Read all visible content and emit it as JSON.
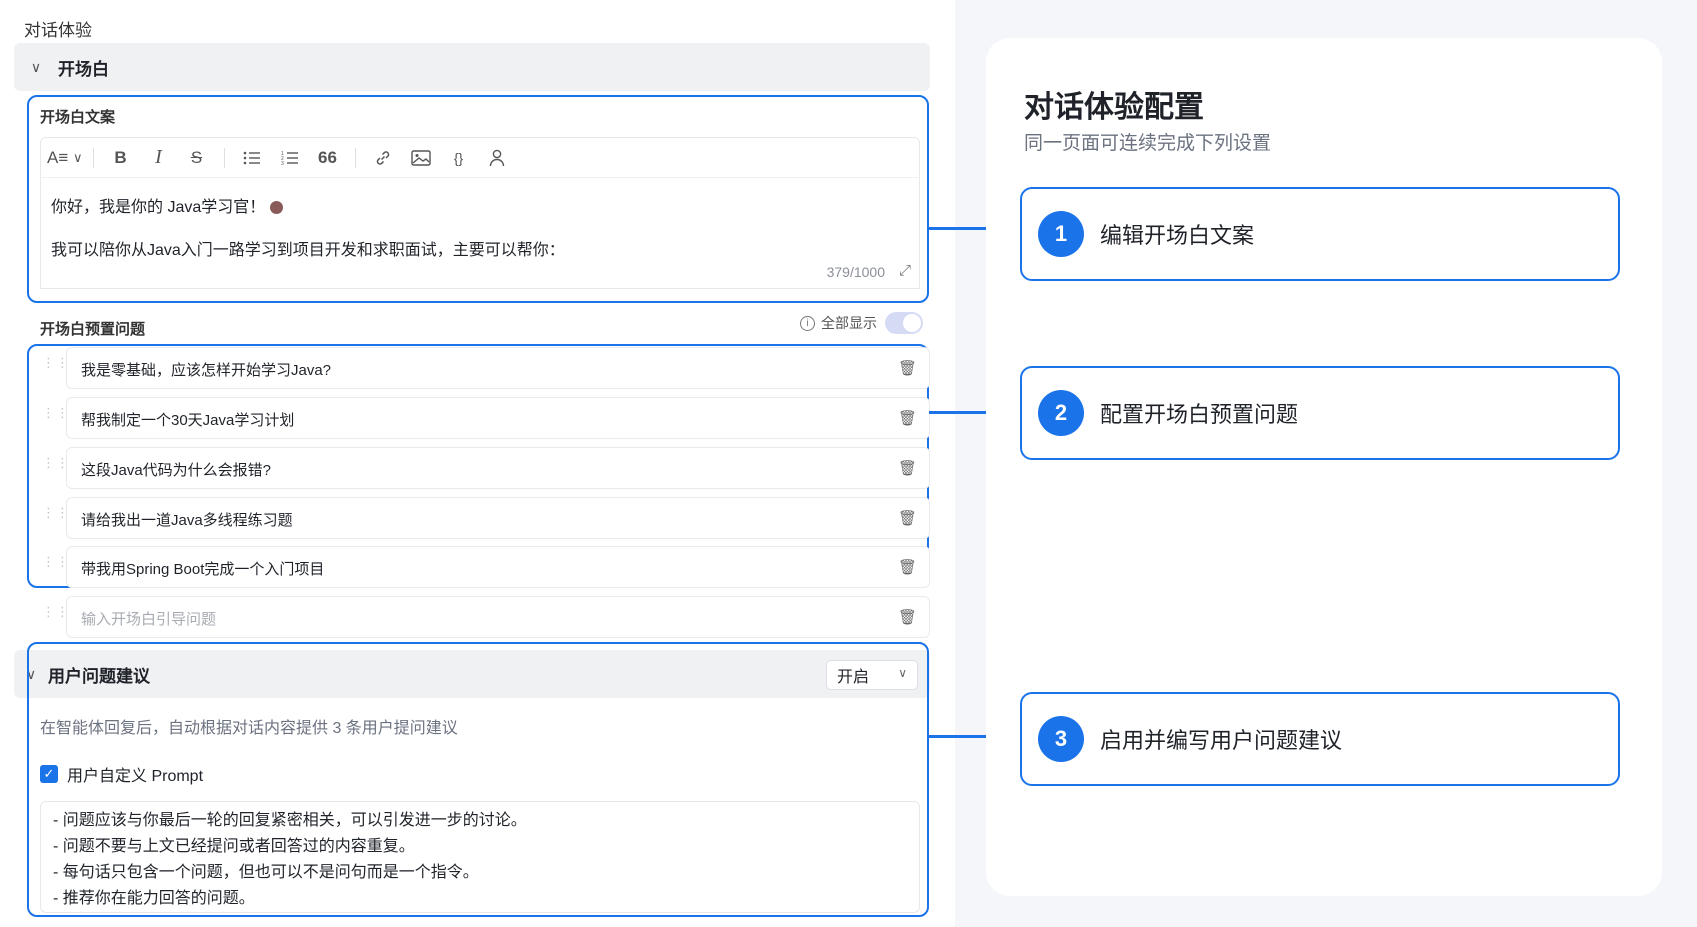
{
  "section_title": "对话体验",
  "opener": {
    "header_title": "开场白",
    "copy_label": "开场白文案",
    "toolbar": {
      "font_size": "A≡",
      "bold": "B",
      "italic": "I",
      "strike": "S",
      "quote": "66",
      "code": "{}"
    },
    "editor_lines": [
      "你好，我是你的 Java学习官！",
      "我可以陪你从Java入门一路学习到项目开发和求职面试，主要可以帮你："
    ],
    "counter": "379/1000",
    "preset_label": "开场白预置问题",
    "show_all_label": "全部显示",
    "show_all_enabled": true,
    "questions": [
      "我是零基础，应该怎样开始学习Java?",
      "帮我制定一个30天Java学习计划",
      "这段Java代码为什么会报错?",
      "请给我出一道Java多线程练习题",
      "带我用Spring Boot完成一个入门项目"
    ],
    "question_placeholder": "输入开场白引导问题"
  },
  "suggestions": {
    "header_title": "用户问题建议",
    "select_value": "开启",
    "description": "在智能体回复后，自动根据对话内容提供 3 条用户提问建议",
    "custom_prompt_label": "用户自定义 Prompt",
    "custom_prompt_checked": true,
    "prompt_lines": [
      "- 问题应该与你最后一轮的回复紧密相关，可以引发进一步的讨论。",
      "- 问题不要与上文已经提问或者回答过的内容重复。",
      "- 每句话只包含一个问题，但也可以不是问句而是一个指令。",
      "- 推荐你在能力回答的问题。"
    ]
  },
  "panel": {
    "title": "对话体验配置",
    "subtitle": "同一页面可连续完成下列设置",
    "steps": [
      {
        "num": "1",
        "label": "编辑开场白文案"
      },
      {
        "num": "2",
        "label": "配置开场白预置问题"
      },
      {
        "num": "3",
        "label": "启用并编写用户问题建议"
      }
    ]
  },
  "colors": {
    "accent": "#1a73e8",
    "header_bg": "#f0f1f3",
    "right_bg": "#f4f6f9"
  },
  "icons": [
    "chevron-down-icon",
    "bullet-list-icon",
    "numbered-list-icon",
    "link-icon",
    "image-icon",
    "user-icon",
    "expand-icon",
    "info-icon",
    "drag-handle-icon",
    "trash-icon",
    "check-icon"
  ]
}
